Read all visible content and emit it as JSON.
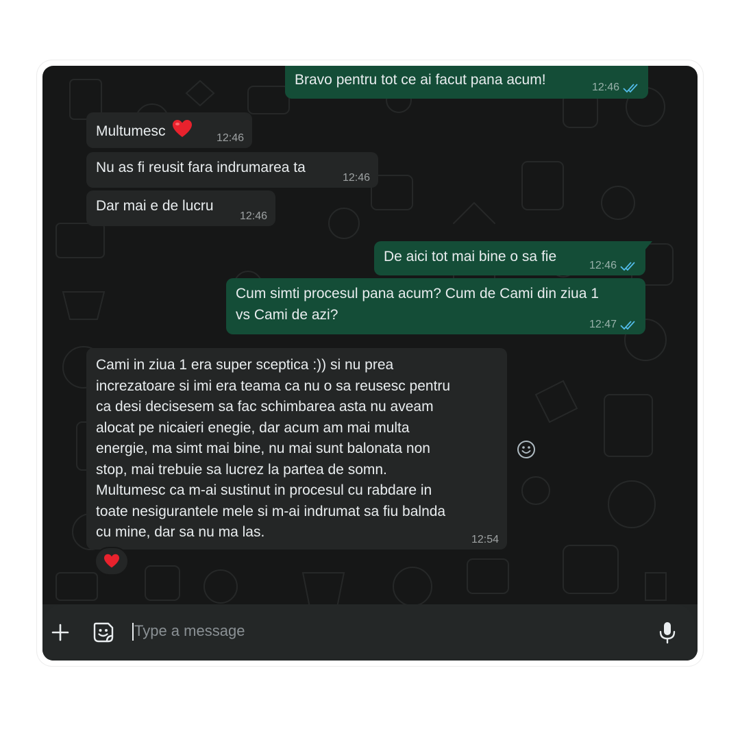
{
  "messages": [
    {
      "id": "m1",
      "direction": "out",
      "text": "Bravo pentru tot ce ai facut pana acum!",
      "time": "12:46",
      "read": true
    },
    {
      "id": "m2",
      "direction": "in",
      "text": "Multumesc",
      "emoji": "heart",
      "time": "12:46"
    },
    {
      "id": "m3",
      "direction": "in",
      "text": "Nu as fi reusit fara indrumarea ta",
      "time": "12:46"
    },
    {
      "id": "m4",
      "direction": "in",
      "text": "Dar mai e de lucru",
      "time": "12:46"
    },
    {
      "id": "m5",
      "direction": "out",
      "text": "De aici tot mai bine o sa fie",
      "time": "12:46",
      "read": true
    },
    {
      "id": "m6",
      "direction": "out",
      "lines": [
        "Cum simti procesul pana acum? Cum de Cami din ziua 1",
        "vs Cami de azi?"
      ],
      "time": "12:47",
      "read": true
    },
    {
      "id": "m7",
      "direction": "in",
      "lines": [
        "Cami in ziua 1 era super sceptica :)) si nu prea",
        "increzatoare si imi era teama ca nu o sa reusesc pentru",
        "ca desi decisesem sa fac schimbarea asta nu aveam",
        "alocat pe nicaieri enegie, dar acum am mai multa",
        "energie, ma simt mai bine, nu mai sunt balonata non",
        "stop, mai trebuie sa lucrez la partea de somn.",
        "Multumesc ca m-ai sustinut in procesul cu rabdare  in",
        "toate nesigurantele mele si m-ai indrumat sa fiu balnda",
        "cu mine, dar sa nu ma las."
      ],
      "time": "12:54",
      "reaction": "heart"
    }
  ],
  "composer": {
    "placeholder": "Type a message",
    "icons": [
      "plus-icon",
      "sticker-icon",
      "microphone-icon"
    ]
  },
  "colors": {
    "background": "#161717",
    "incoming_bubble": "#242626",
    "outgoing_bubble": "#144d37",
    "text": "#e9edef",
    "read_ticks": "#53bdeb",
    "heart": "#e8222d"
  }
}
